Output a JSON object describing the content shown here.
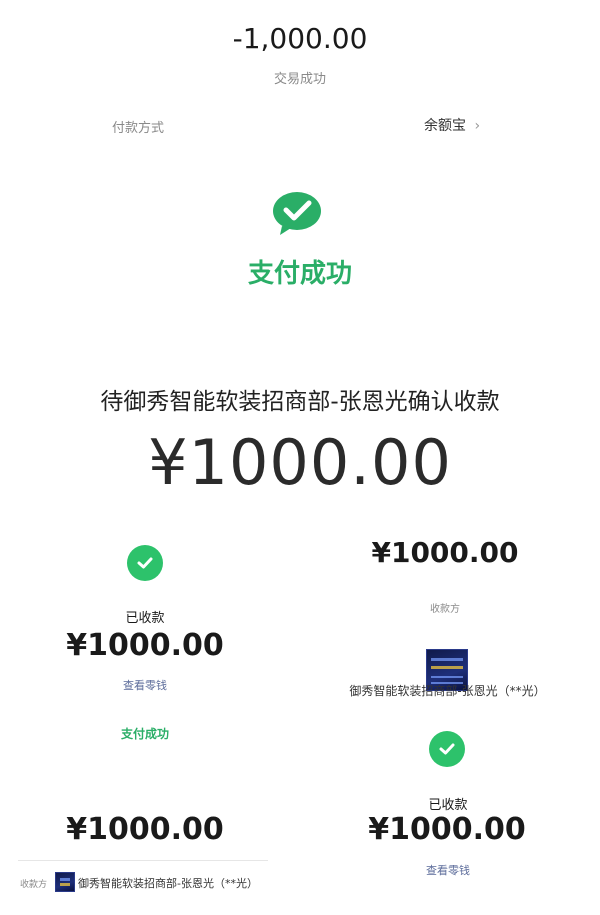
{
  "top": {
    "amount": "-1,000.00",
    "status": "交易成功",
    "payment_method_label": "付款方式",
    "payment_method_value": "余额宝",
    "payment_method_chevron": "›"
  },
  "wechat_success": {
    "icon": "wechat-pay-icon",
    "text": "支付成功"
  },
  "confirm": {
    "title": "待御秀智能软装招商部-张恩光确认收款",
    "amount": "¥1000.00"
  },
  "left_receipt": {
    "status": "已收款",
    "amount": "¥1000.00",
    "link": "查看零钱",
    "pay_success": "支付成功",
    "amount2": "¥1000.00",
    "payee_label": "收款方",
    "payee_name": "御秀智能软装招商部-张恩光（**光）"
  },
  "right_receipt": {
    "amount": "¥1000.00",
    "payee_label": "收款方",
    "payee_name": "御秀智能软装招商部-张恩光（**光）",
    "status": "已收款",
    "amount2": "¥1000.00",
    "link": "查看零钱"
  },
  "colors": {
    "green": "#2aae67",
    "check_green": "#2dc26b",
    "link": "#5b6b9a",
    "gray": "#8a8a8a"
  }
}
